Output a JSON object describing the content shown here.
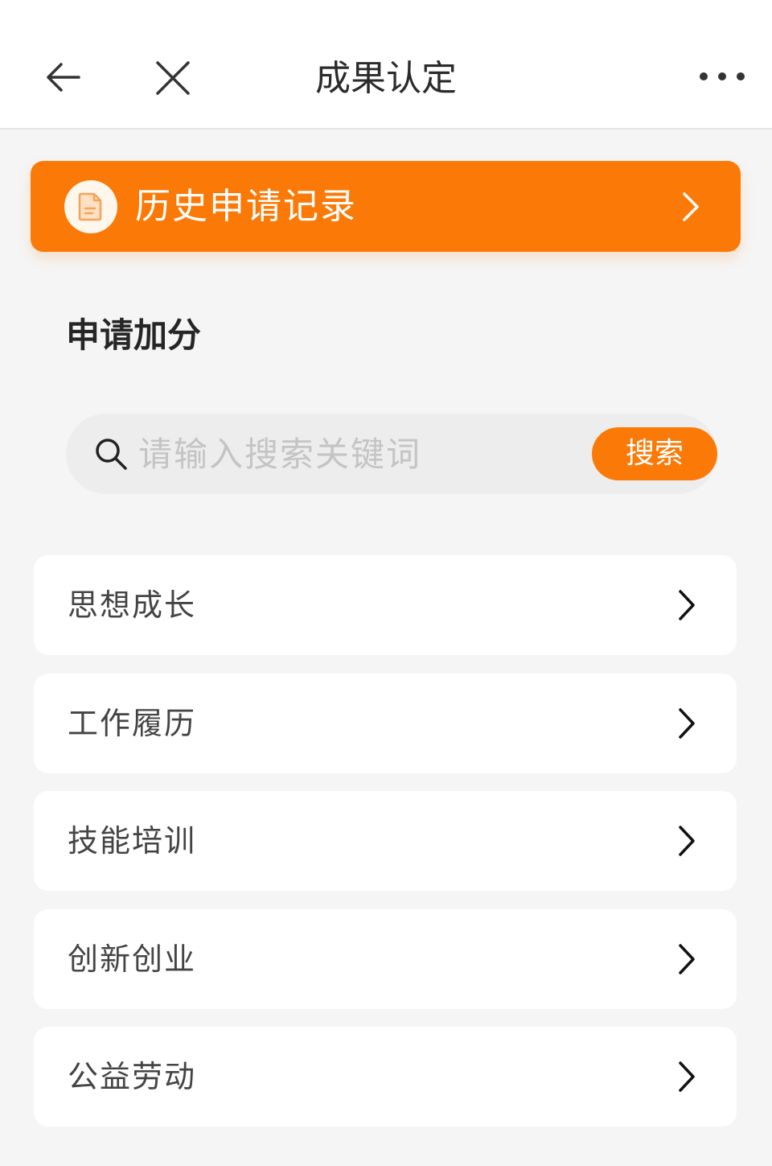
{
  "nav": {
    "title": "成果认定",
    "back_icon": "arrow-left-icon",
    "close_icon": "close-icon",
    "more_icon": "more-dots-icon"
  },
  "history": {
    "label": "历史申请记录",
    "icon": "document-icon",
    "chevron_icon": "chevron-right-icon"
  },
  "section": {
    "title": "申请加分"
  },
  "search": {
    "placeholder": "请输入搜索关键词",
    "value": "",
    "button_label": "搜索",
    "icon": "search-icon"
  },
  "categories": [
    {
      "label": "思想成长"
    },
    {
      "label": "工作履历"
    },
    {
      "label": "技能培训"
    },
    {
      "label": "创新创业"
    },
    {
      "label": "公益劳动"
    }
  ],
  "colors": {
    "accent": "#fb7a07",
    "background": "#f5f5f5",
    "card": "#ffffff",
    "search_bg": "#ededed",
    "placeholder": "#c4c4c4"
  }
}
